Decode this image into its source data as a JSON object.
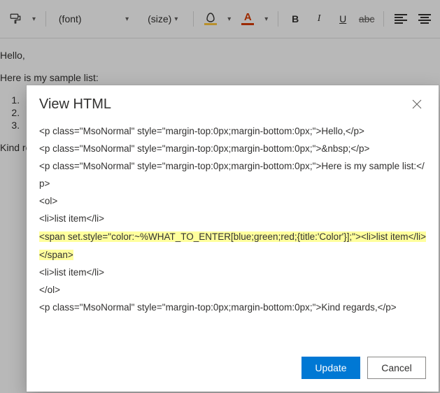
{
  "toolbar": {
    "font_placeholder": "(font)",
    "size_placeholder": "(size)",
    "bold": "B",
    "italic": "I",
    "underline": "U",
    "strike": "abc",
    "font_color_letter": "A"
  },
  "editor": {
    "greeting": "Hello,",
    "intro": "Here is my sample list:",
    "list": [
      "1.",
      "2.",
      "3."
    ],
    "closing": "Kind re"
  },
  "modal": {
    "title": "View HTML",
    "lines": [
      "<p class=\"MsoNormal\" style=\"margin-top:0px;margin-bottom:0px;\">Hello,</p>",
      "<p class=\"MsoNormal\" style=\"margin-top:0px;margin-bottom:0px;\">&nbsp;</p>",
      "<p class=\"MsoNormal\" style=\"margin-top:0px;margin-bottom:0px;\">Here is my sample list:</p>",
      "<ol>",
      "<li>list item</li>",
      "<span set.style=\"color:~%WHAT_TO_ENTER[blue;green;red;{title:'Color'}];\"><li>list item</li></span>",
      "<li>list item</li>",
      "</ol>",
      "<p class=\"MsoNormal\" style=\"margin-top:0px;margin-bottom:0px;\">Kind regards,</p>"
    ],
    "highlight_index": 5,
    "update_label": "Update",
    "cancel_label": "Cancel"
  }
}
